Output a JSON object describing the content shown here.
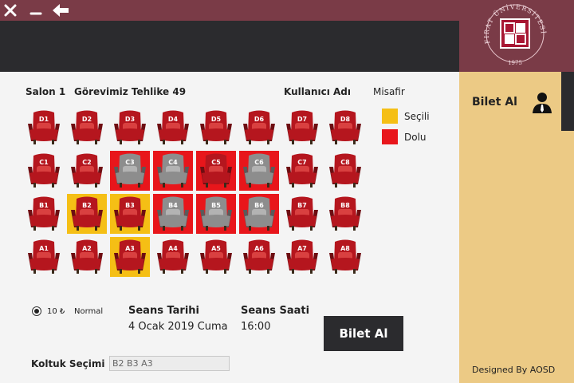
{
  "window": {
    "close_glyph": "✕",
    "minimize_glyph": "—",
    "back_glyph": "⬅"
  },
  "header": {
    "salon": "Salon 1",
    "movie": "Görevimiz Tehlike 49",
    "user_label": "Kullanıcı Adı",
    "user_value": "Misafir"
  },
  "legend": {
    "selected": "Seçili",
    "occupied": "Dolu"
  },
  "colors": {
    "selected": "#f5bf15",
    "occupied": "#e8161b",
    "seat_red": "#b5161e",
    "seat_grey": "#8d8d8d"
  },
  "seats": [
    [
      {
        "code": "D1",
        "state": "free"
      },
      {
        "code": "D2",
        "state": "free"
      },
      {
        "code": "D3",
        "state": "free"
      },
      {
        "code": "D4",
        "state": "free"
      },
      {
        "code": "D5",
        "state": "free"
      },
      {
        "code": "D6",
        "state": "free"
      },
      {
        "code": "D7",
        "state": "free"
      },
      {
        "code": "D8",
        "state": "free"
      }
    ],
    [
      {
        "code": "C1",
        "state": "free"
      },
      {
        "code": "C2",
        "state": "free"
      },
      {
        "code": "C3",
        "state": "occupied"
      },
      {
        "code": "C4",
        "state": "occupied"
      },
      {
        "code": "C5",
        "state": "occupied-red"
      },
      {
        "code": "C6",
        "state": "occupied"
      },
      {
        "code": "C7",
        "state": "free"
      },
      {
        "code": "C8",
        "state": "free"
      }
    ],
    [
      {
        "code": "B1",
        "state": "free"
      },
      {
        "code": "B2",
        "state": "selected"
      },
      {
        "code": "B3",
        "state": "selected"
      },
      {
        "code": "B4",
        "state": "occupied"
      },
      {
        "code": "B5",
        "state": "occupied"
      },
      {
        "code": "B6",
        "state": "occupied"
      },
      {
        "code": "B7",
        "state": "free"
      },
      {
        "code": "B8",
        "state": "free"
      }
    ],
    [
      {
        "code": "A1",
        "state": "free"
      },
      {
        "code": "A2",
        "state": "free"
      },
      {
        "code": "A3",
        "state": "selected"
      },
      {
        "code": "A4",
        "state": "free"
      },
      {
        "code": "A5",
        "state": "free"
      },
      {
        "code": "A6",
        "state": "free"
      },
      {
        "code": "A7",
        "state": "free"
      },
      {
        "code": "A8",
        "state": "free"
      }
    ]
  ],
  "ticket": {
    "price": "10 ₺",
    "type": "Normal"
  },
  "session": {
    "date_label": "Seans Tarihi",
    "date_value": "4 Ocak 2019 Cuma",
    "time_label": "Seans Saati",
    "time_value": "16:00"
  },
  "buy_button": "Bilet Al",
  "seat_selection": {
    "label": "Koltuk Seçimi",
    "value": "B2 B3 A3"
  },
  "sidebar": {
    "logo_arc_text": "FIRAT ÜNİVERSİTESİ",
    "logo_year": "1975",
    "menu_item": "Bilet Al",
    "menu_icon": "user-icon",
    "footer": "Designed By AOSD"
  }
}
